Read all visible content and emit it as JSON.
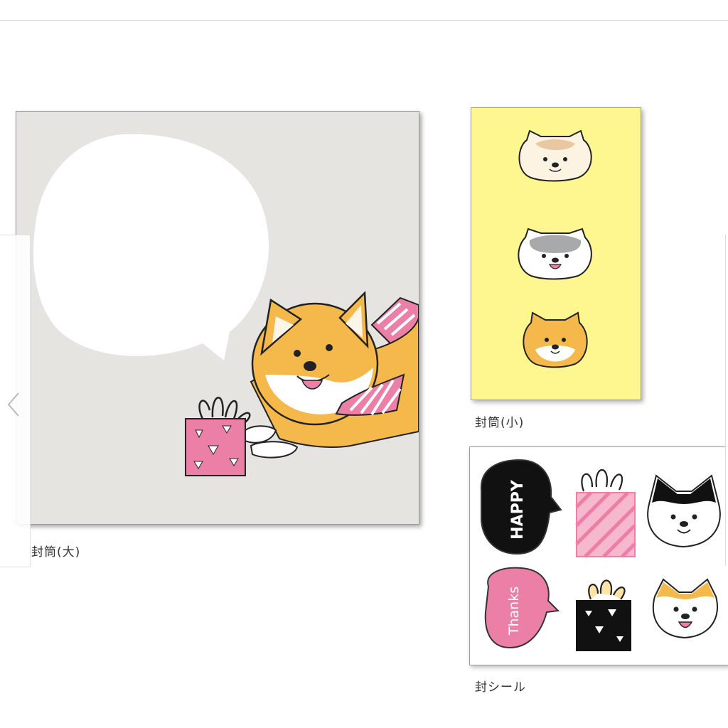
{
  "captions": {
    "large_envelope": "封筒(大)",
    "small_envelope": "封筒(小)",
    "seal_sticker": "封シール"
  },
  "stickers": {
    "happy": "HAPPY",
    "thanks": "Thanks"
  },
  "icons": {
    "prev": "chevron-left-icon",
    "next": "chevron-right-icon"
  },
  "colors": {
    "large_envelope_bg": "#e5e4e1",
    "small_envelope_bg": "#fef68f",
    "shiba_orange": "#f4b94a",
    "accent_pink": "#ec7fa6"
  }
}
